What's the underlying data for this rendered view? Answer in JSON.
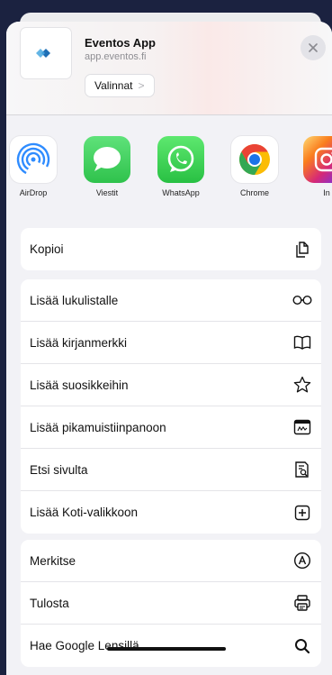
{
  "header": {
    "title": "Eventos App",
    "url": "app.eventos.fi",
    "options_label": "Valinnat",
    "options_chevron": ">",
    "close_label": "×"
  },
  "apps": [
    {
      "label": "AirDrop",
      "icon": "airdrop-icon",
      "color": "#2f8cff"
    },
    {
      "label": "Viestit",
      "icon": "messages-icon",
      "color": "#34c759"
    },
    {
      "label": "WhatsApp",
      "icon": "whatsapp-icon",
      "color": "#25d366"
    },
    {
      "label": "Chrome",
      "icon": "chrome-icon",
      "color": "#ffffff"
    },
    {
      "label": "In",
      "icon": "instagram-icon",
      "color": "#d62976"
    }
  ],
  "actions": {
    "group1": [
      {
        "label": "Kopioi",
        "icon": "copy-icon"
      }
    ],
    "group2": [
      {
        "label": "Lisää lukulistalle",
        "icon": "reading-glasses-icon"
      },
      {
        "label": "Lisää kirjanmerkki",
        "icon": "book-icon"
      },
      {
        "label": "Lisää suosikkeihin",
        "icon": "star-icon"
      },
      {
        "label": "Lisää pikamuistiinpanoon",
        "icon": "quick-note-icon"
      },
      {
        "label": "Etsi sivulta",
        "icon": "find-in-page-icon"
      },
      {
        "label": "Lisää Koti-valikkoon",
        "icon": "add-square-icon"
      }
    ],
    "group3": [
      {
        "label": "Merkitse",
        "icon": "markup-icon"
      },
      {
        "label": "Tulosta",
        "icon": "printer-icon"
      },
      {
        "label": "Hae Google Lensillä",
        "icon": "search-icon"
      }
    ]
  }
}
